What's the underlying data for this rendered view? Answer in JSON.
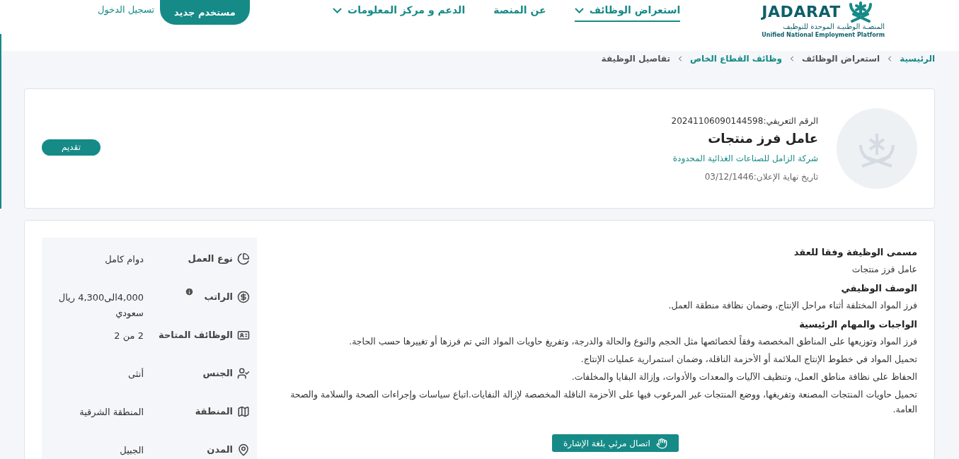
{
  "header": {
    "logo": {
      "name": "JADARAT",
      "arabic": "المنصـة الوطنيـة الموحدة للتوظيف",
      "english": "Unified National Employment Platform"
    },
    "nav": [
      {
        "label": "استعراض الوظائف",
        "selected": true,
        "dropdown": true
      },
      {
        "label": "عن المنصة",
        "selected": false,
        "dropdown": false
      },
      {
        "label": "الدعم و مركز المعلومات",
        "selected": false,
        "dropdown": true
      }
    ],
    "register_button": "مستخدم جديد",
    "login_link": "تسجيل الدخول"
  },
  "breadcrumb": [
    {
      "label": "الرئيسية",
      "link": true
    },
    {
      "label": "استعراض الوظائف",
      "link": false
    },
    {
      "label": "وظائف القطاع الخاص",
      "link": true
    },
    {
      "label": "تفاصيل الوظيفة",
      "link": false
    }
  ],
  "job": {
    "reference": "الرقم التعريفي:20241106090144598",
    "title": "عامل فرز منتجات",
    "company": "شركة الزامل للصناعات الغذائية المحدودة",
    "deadline": "تاريخ نهاية الإعلان:03/12/1446",
    "apply_button": "تقديم"
  },
  "sections": [
    {
      "heading": "مسمى الوظيفة وفقا للعقد",
      "lines": [
        "عامل فرز منتجات"
      ]
    },
    {
      "heading": "الوصف الوظيفي",
      "lines": [
        "فرز المواد المختلفة أثناء مراحل الإنتاج، وضمان نظافة منطقة العمل."
      ]
    },
    {
      "heading": "الواجبات والمهام الرئيسية",
      "lines": [
        "فرز المواد وتوزيعها على المناطق المخصصة وفقاً لخصائصها مثل الحجم والنوع والحالة والدرجة، وتفريغ حاويات المواد التي تم فرزها أو تغييرها حسب الحاجة.",
        "تحميل المواد في خطوط الإنتاج الملائمة أو الأحزمة الناقلة، وضمان استمرارية عمليات الإنتاج.",
        "الحفاظ على نظافة مناطق العمل، وتنظيف الآليات والمعدات والأدوات، وإزالة البقايا والمخلفات.",
        "تحميل حاويات المنتجات المصنعة وتفريغها، ووضع المنتجات غير المرغوب فيها على الأحزمة الناقلة المخصصة لإزالة النفايات.اتباع سياسات وإجراءات الصحة والسلامة والصحة العامة."
      ]
    }
  ],
  "attributes": [
    {
      "kind": "clock",
      "label": "نوع العمل",
      "value": "دوام كامل",
      "info": false
    },
    {
      "kind": "money",
      "label": "الراتب",
      "value": "4,000الى4,300 ريال سعودي",
      "info": true
    },
    {
      "kind": "idcard",
      "label": "الوظائف المتاحة",
      "value": "2 من 2",
      "info": false
    },
    {
      "kind": "person",
      "label": "الجنس",
      "value": "أنثى",
      "info": false
    },
    {
      "kind": "map",
      "label": "المنطقة",
      "value": "المنطقة الشرقية",
      "info": false
    },
    {
      "kind": "pin",
      "label": "المدن",
      "value": "الجبيل",
      "info": false
    }
  ],
  "sign_language_button": "اتصال مرئي بلغة الإشارة"
}
